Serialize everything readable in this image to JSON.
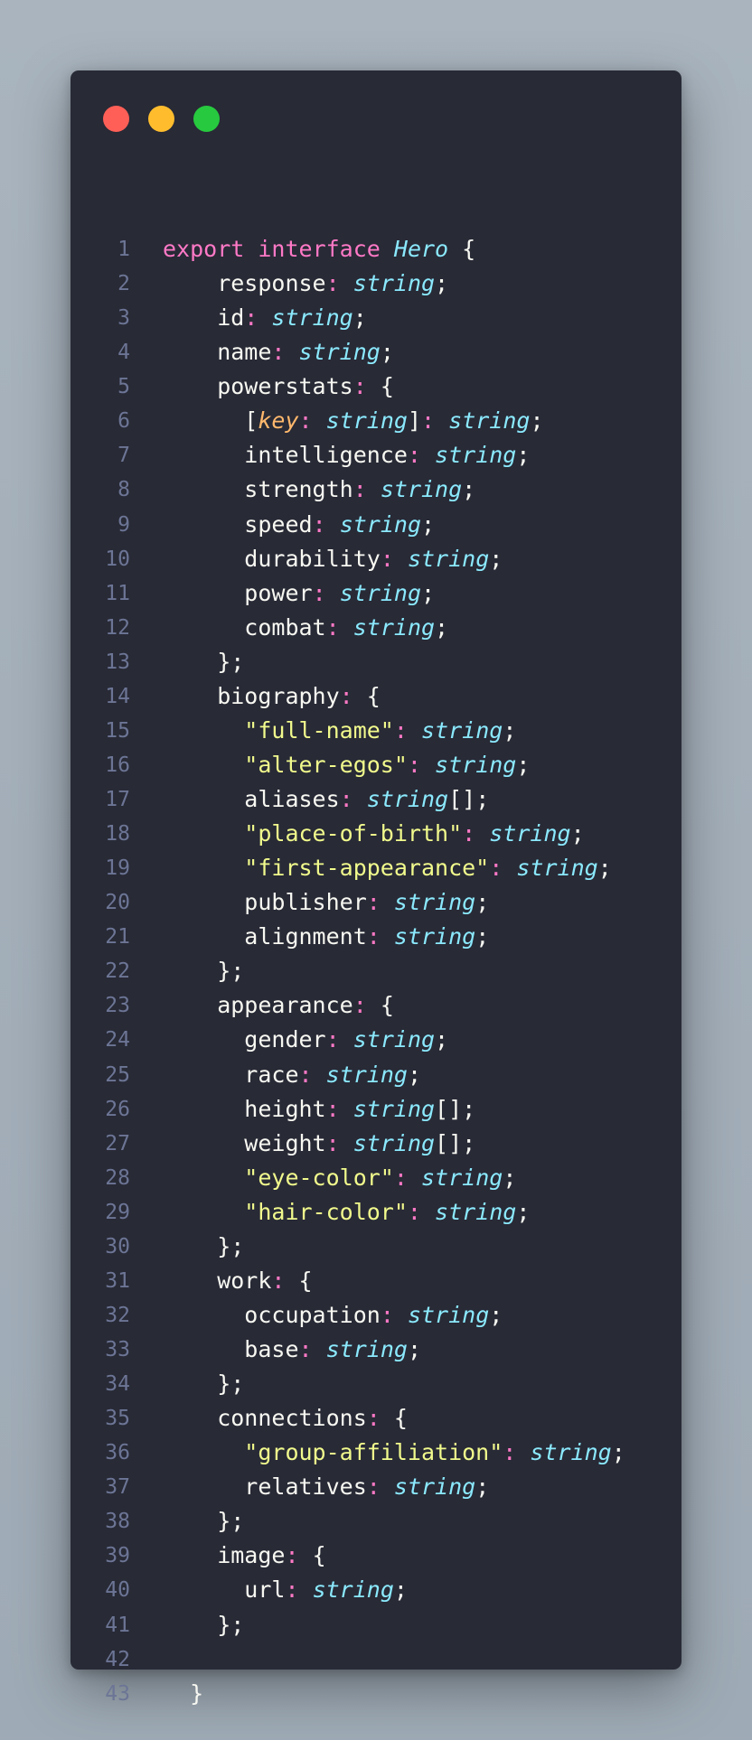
{
  "window": {
    "controls": [
      "close",
      "minimize",
      "maximize"
    ]
  },
  "colors": {
    "background": "#a3aeb9",
    "editor": "#282a36",
    "keyword": "#ff79c6",
    "type": "#8be9fd",
    "string": "#f1fa8c",
    "param": "#ffb86c",
    "text": "#f8f8f2",
    "line_number": "#6c7595"
  },
  "code": {
    "lines": [
      {
        "n": "1",
        "indent": 0,
        "tokens": [
          [
            "export",
            "keyword"
          ],
          [
            " ",
            "default"
          ],
          [
            "interface",
            "keyword"
          ],
          [
            " ",
            "default"
          ],
          [
            "Hero",
            "type"
          ],
          [
            " {",
            "default"
          ]
        ]
      },
      {
        "n": "2",
        "indent": 4,
        "tokens": [
          [
            "response",
            "default"
          ],
          [
            ":",
            "punct"
          ],
          [
            " ",
            "default"
          ],
          [
            "string",
            "type"
          ],
          [
            ";",
            "default"
          ]
        ]
      },
      {
        "n": "3",
        "indent": 4,
        "tokens": [
          [
            "id",
            "default"
          ],
          [
            ":",
            "punct"
          ],
          [
            " ",
            "default"
          ],
          [
            "string",
            "type"
          ],
          [
            ";",
            "default"
          ]
        ]
      },
      {
        "n": "4",
        "indent": 4,
        "tokens": [
          [
            "name",
            "default"
          ],
          [
            ":",
            "punct"
          ],
          [
            " ",
            "default"
          ],
          [
            "string",
            "type"
          ],
          [
            ";",
            "default"
          ]
        ]
      },
      {
        "n": "5",
        "indent": 4,
        "tokens": [
          [
            "powerstats",
            "default"
          ],
          [
            ":",
            "punct"
          ],
          [
            " {",
            "default"
          ]
        ]
      },
      {
        "n": "6",
        "indent": 6,
        "tokens": [
          [
            "[",
            "default"
          ],
          [
            "key",
            "param"
          ],
          [
            ":",
            "punct"
          ],
          [
            " ",
            "default"
          ],
          [
            "string",
            "type"
          ],
          [
            "]",
            "default"
          ],
          [
            ":",
            "punct"
          ],
          [
            " ",
            "default"
          ],
          [
            "string",
            "type"
          ],
          [
            ";",
            "default"
          ]
        ]
      },
      {
        "n": "7",
        "indent": 6,
        "tokens": [
          [
            "intelligence",
            "default"
          ],
          [
            ":",
            "punct"
          ],
          [
            " ",
            "default"
          ],
          [
            "string",
            "type"
          ],
          [
            ";",
            "default"
          ]
        ]
      },
      {
        "n": "8",
        "indent": 6,
        "tokens": [
          [
            "strength",
            "default"
          ],
          [
            ":",
            "punct"
          ],
          [
            " ",
            "default"
          ],
          [
            "string",
            "type"
          ],
          [
            ";",
            "default"
          ]
        ]
      },
      {
        "n": "9",
        "indent": 6,
        "tokens": [
          [
            "speed",
            "default"
          ],
          [
            ":",
            "punct"
          ],
          [
            " ",
            "default"
          ],
          [
            "string",
            "type"
          ],
          [
            ";",
            "default"
          ]
        ]
      },
      {
        "n": "10",
        "indent": 6,
        "tokens": [
          [
            "durability",
            "default"
          ],
          [
            ":",
            "punct"
          ],
          [
            " ",
            "default"
          ],
          [
            "string",
            "type"
          ],
          [
            ";",
            "default"
          ]
        ]
      },
      {
        "n": "11",
        "indent": 6,
        "tokens": [
          [
            "power",
            "default"
          ],
          [
            ":",
            "punct"
          ],
          [
            " ",
            "default"
          ],
          [
            "string",
            "type"
          ],
          [
            ";",
            "default"
          ]
        ]
      },
      {
        "n": "12",
        "indent": 6,
        "tokens": [
          [
            "combat",
            "default"
          ],
          [
            ":",
            "punct"
          ],
          [
            " ",
            "default"
          ],
          [
            "string",
            "type"
          ],
          [
            ";",
            "default"
          ]
        ]
      },
      {
        "n": "13",
        "indent": 4,
        "tokens": [
          [
            "};",
            "default"
          ]
        ]
      },
      {
        "n": "14",
        "indent": 4,
        "tokens": [
          [
            "biography",
            "default"
          ],
          [
            ":",
            "punct"
          ],
          [
            " {",
            "default"
          ]
        ]
      },
      {
        "n": "15",
        "indent": 6,
        "tokens": [
          [
            "\"full-name\"",
            "string"
          ],
          [
            ":",
            "punct"
          ],
          [
            " ",
            "default"
          ],
          [
            "string",
            "type"
          ],
          [
            ";",
            "default"
          ]
        ]
      },
      {
        "n": "16",
        "indent": 6,
        "tokens": [
          [
            "\"alter-egos\"",
            "string"
          ],
          [
            ":",
            "punct"
          ],
          [
            " ",
            "default"
          ],
          [
            "string",
            "type"
          ],
          [
            ";",
            "default"
          ]
        ]
      },
      {
        "n": "17",
        "indent": 6,
        "tokens": [
          [
            "aliases",
            "default"
          ],
          [
            ":",
            "punct"
          ],
          [
            " ",
            "default"
          ],
          [
            "string",
            "type"
          ],
          [
            "[];",
            "default"
          ]
        ]
      },
      {
        "n": "18",
        "indent": 6,
        "tokens": [
          [
            "\"place-of-birth\"",
            "string"
          ],
          [
            ":",
            "punct"
          ],
          [
            " ",
            "default"
          ],
          [
            "string",
            "type"
          ],
          [
            ";",
            "default"
          ]
        ]
      },
      {
        "n": "19",
        "indent": 6,
        "tokens": [
          [
            "\"first-appearance\"",
            "string"
          ],
          [
            ":",
            "punct"
          ],
          [
            " ",
            "default"
          ],
          [
            "string",
            "type"
          ],
          [
            ";",
            "default"
          ]
        ]
      },
      {
        "n": "20",
        "indent": 6,
        "tokens": [
          [
            "publisher",
            "default"
          ],
          [
            ":",
            "punct"
          ],
          [
            " ",
            "default"
          ],
          [
            "string",
            "type"
          ],
          [
            ";",
            "default"
          ]
        ]
      },
      {
        "n": "21",
        "indent": 6,
        "tokens": [
          [
            "alignment",
            "default"
          ],
          [
            ":",
            "punct"
          ],
          [
            " ",
            "default"
          ],
          [
            "string",
            "type"
          ],
          [
            ";",
            "default"
          ]
        ]
      },
      {
        "n": "22",
        "indent": 4,
        "tokens": [
          [
            "};",
            "default"
          ]
        ]
      },
      {
        "n": "23",
        "indent": 4,
        "tokens": [
          [
            "appearance",
            "default"
          ],
          [
            ":",
            "punct"
          ],
          [
            " {",
            "default"
          ]
        ]
      },
      {
        "n": "24",
        "indent": 6,
        "tokens": [
          [
            "gender",
            "default"
          ],
          [
            ":",
            "punct"
          ],
          [
            " ",
            "default"
          ],
          [
            "string",
            "type"
          ],
          [
            ";",
            "default"
          ]
        ]
      },
      {
        "n": "25",
        "indent": 6,
        "tokens": [
          [
            "race",
            "default"
          ],
          [
            ":",
            "punct"
          ],
          [
            " ",
            "default"
          ],
          [
            "string",
            "type"
          ],
          [
            ";",
            "default"
          ]
        ]
      },
      {
        "n": "26",
        "indent": 6,
        "tokens": [
          [
            "height",
            "default"
          ],
          [
            ":",
            "punct"
          ],
          [
            " ",
            "default"
          ],
          [
            "string",
            "type"
          ],
          [
            "[];",
            "default"
          ]
        ]
      },
      {
        "n": "27",
        "indent": 6,
        "tokens": [
          [
            "weight",
            "default"
          ],
          [
            ":",
            "punct"
          ],
          [
            " ",
            "default"
          ],
          [
            "string",
            "type"
          ],
          [
            "[];",
            "default"
          ]
        ]
      },
      {
        "n": "28",
        "indent": 6,
        "tokens": [
          [
            "\"eye-color\"",
            "string"
          ],
          [
            ":",
            "punct"
          ],
          [
            " ",
            "default"
          ],
          [
            "string",
            "type"
          ],
          [
            ";",
            "default"
          ]
        ]
      },
      {
        "n": "29",
        "indent": 6,
        "tokens": [
          [
            "\"hair-color\"",
            "string"
          ],
          [
            ":",
            "punct"
          ],
          [
            " ",
            "default"
          ],
          [
            "string",
            "type"
          ],
          [
            ";",
            "default"
          ]
        ]
      },
      {
        "n": "30",
        "indent": 4,
        "tokens": [
          [
            "};",
            "default"
          ]
        ]
      },
      {
        "n": "31",
        "indent": 4,
        "tokens": [
          [
            "work",
            "default"
          ],
          [
            ":",
            "punct"
          ],
          [
            " {",
            "default"
          ]
        ]
      },
      {
        "n": "32",
        "indent": 6,
        "tokens": [
          [
            "occupation",
            "default"
          ],
          [
            ":",
            "punct"
          ],
          [
            " ",
            "default"
          ],
          [
            "string",
            "type"
          ],
          [
            ";",
            "default"
          ]
        ]
      },
      {
        "n": "33",
        "indent": 6,
        "tokens": [
          [
            "base",
            "default"
          ],
          [
            ":",
            "punct"
          ],
          [
            " ",
            "default"
          ],
          [
            "string",
            "type"
          ],
          [
            ";",
            "default"
          ]
        ]
      },
      {
        "n": "34",
        "indent": 4,
        "tokens": [
          [
            "};",
            "default"
          ]
        ]
      },
      {
        "n": "35",
        "indent": 4,
        "tokens": [
          [
            "connections",
            "default"
          ],
          [
            ":",
            "punct"
          ],
          [
            " {",
            "default"
          ]
        ]
      },
      {
        "n": "36",
        "indent": 6,
        "tokens": [
          [
            "\"group-affiliation\"",
            "string"
          ],
          [
            ":",
            "punct"
          ],
          [
            " ",
            "default"
          ],
          [
            "string",
            "type"
          ],
          [
            ";",
            "default"
          ]
        ]
      },
      {
        "n": "37",
        "indent": 6,
        "tokens": [
          [
            "relatives",
            "default"
          ],
          [
            ":",
            "punct"
          ],
          [
            " ",
            "default"
          ],
          [
            "string",
            "type"
          ],
          [
            ";",
            "default"
          ]
        ]
      },
      {
        "n": "38",
        "indent": 4,
        "tokens": [
          [
            "};",
            "default"
          ]
        ]
      },
      {
        "n": "39",
        "indent": 4,
        "tokens": [
          [
            "image",
            "default"
          ],
          [
            ":",
            "punct"
          ],
          [
            " {",
            "default"
          ]
        ]
      },
      {
        "n": "40",
        "indent": 6,
        "tokens": [
          [
            "url",
            "default"
          ],
          [
            ":",
            "punct"
          ],
          [
            " ",
            "default"
          ],
          [
            "string",
            "type"
          ],
          [
            ";",
            "default"
          ]
        ]
      },
      {
        "n": "41",
        "indent": 4,
        "tokens": [
          [
            "};",
            "default"
          ]
        ]
      },
      {
        "n": "42",
        "indent": 0,
        "tokens": []
      },
      {
        "n": "43",
        "indent": 2,
        "tokens": [
          [
            "}",
            "default"
          ]
        ]
      }
    ]
  }
}
